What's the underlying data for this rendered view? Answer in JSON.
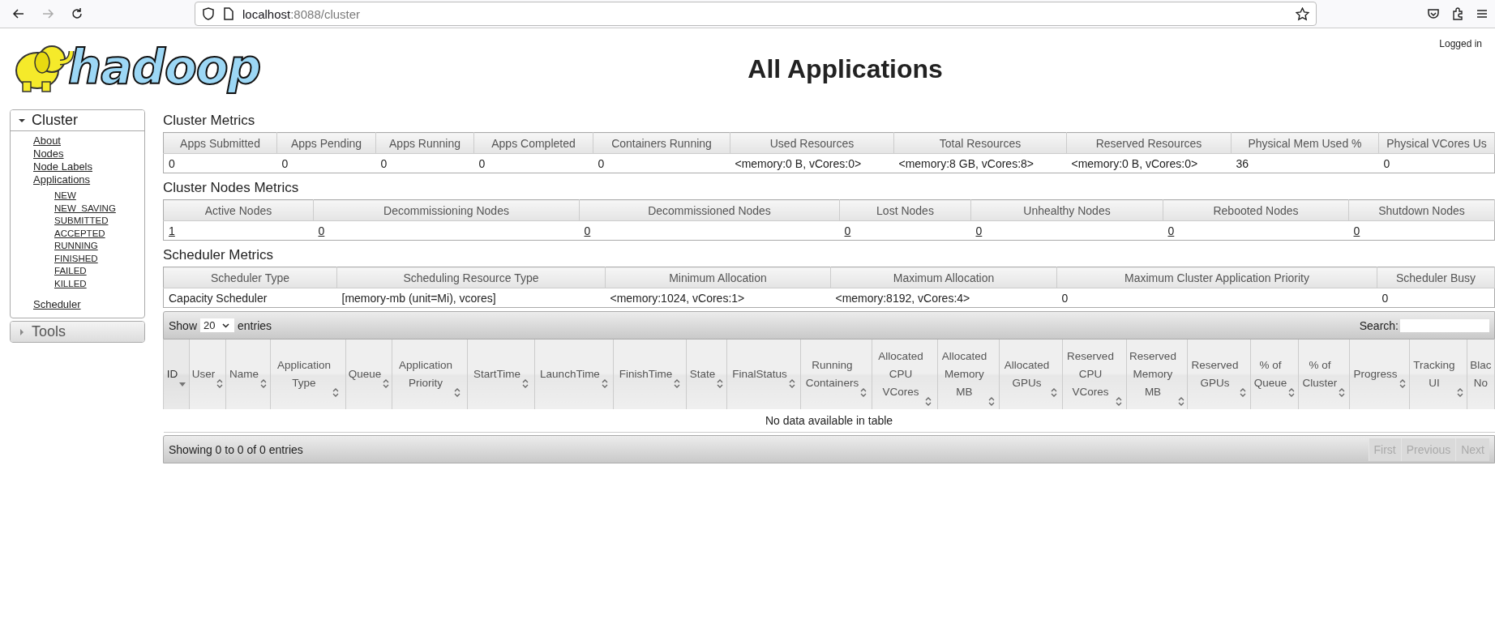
{
  "browser": {
    "back_disabled": false,
    "forward_disabled": true,
    "url_host": "localhost",
    "url_rest": ":8088/cluster"
  },
  "header": {
    "logo_text": "hadoop",
    "title": "All Applications",
    "logged_in": "Logged in"
  },
  "sidebar": [
    {
      "label": "Cluster",
      "expanded": true,
      "items": [
        {
          "label": "About"
        },
        {
          "label": "Nodes"
        },
        {
          "label": "Node Labels"
        },
        {
          "label": "Applications",
          "children": [
            {
              "label": "NEW"
            },
            {
              "label": "NEW_SAVING"
            },
            {
              "label": "SUBMITTED"
            },
            {
              "label": "ACCEPTED"
            },
            {
              "label": "RUNNING"
            },
            {
              "label": "FINISHED"
            },
            {
              "label": "FAILED"
            },
            {
              "label": "KILLED"
            }
          ]
        },
        {
          "label": "Scheduler"
        }
      ]
    },
    {
      "label": "Tools",
      "expanded": false
    }
  ],
  "metrics": [
    {
      "title": "Cluster Metrics",
      "links": false,
      "columns": [
        "Apps Submitted",
        "Apps Pending",
        "Apps Running",
        "Apps Completed",
        "Containers Running",
        "Used Resources",
        "Total Resources",
        "Reserved Resources",
        "Physical Mem Used %",
        "Physical VCores Us"
      ],
      "row": [
        "0",
        "0",
        "0",
        "0",
        "0",
        "<memory:0 B, vCores:0>",
        "<memory:8 GB, vCores:8>",
        "<memory:0 B, vCores:0>",
        "36",
        "0"
      ]
    },
    {
      "title": "Cluster Nodes Metrics",
      "links": true,
      "columns": [
        "Active Nodes",
        "Decommissioning Nodes",
        "Decommissioned Nodes",
        "Lost Nodes",
        "Unhealthy Nodes",
        "Rebooted Nodes",
        "Shutdown Nodes"
      ],
      "row": [
        "1",
        "0",
        "0",
        "0",
        "0",
        "0",
        "0"
      ]
    },
    {
      "title": "Scheduler Metrics",
      "links": false,
      "columns": [
        "Scheduler Type",
        "Scheduling Resource Type",
        "Minimum Allocation",
        "Maximum Allocation",
        "Maximum Cluster Application Priority",
        "Scheduler Busy"
      ],
      "row": [
        "Capacity Scheduler",
        "[memory-mb (unit=Mi), vcores]",
        "<memory:1024, vCores:1>",
        "<memory:8192, vCores:4>",
        "0",
        "0"
      ]
    }
  ],
  "apps": {
    "show_label": "Show",
    "page_length": "20",
    "entries_label": "entries",
    "search_label": "Search:",
    "columns": [
      {
        "label": "ID",
        "sortable": true,
        "sorted_desc": true
      },
      {
        "label": "User",
        "sortable": true,
        "sorted_desc": false
      },
      {
        "label": "Name",
        "sortable": true,
        "sorted_desc": false
      },
      {
        "label": "Application\nType",
        "sortable": true,
        "sorted_desc": false
      },
      {
        "label": "Queue",
        "sortable": true,
        "sorted_desc": false
      },
      {
        "label": "Application\nPriority",
        "sortable": true,
        "sorted_desc": false
      },
      {
        "label": "StartTime",
        "sortable": true,
        "sorted_desc": false
      },
      {
        "label": "LaunchTime",
        "sortable": true,
        "sorted_desc": false
      },
      {
        "label": "FinishTime",
        "sortable": true,
        "sorted_desc": false
      },
      {
        "label": "State",
        "sortable": true,
        "sorted_desc": false
      },
      {
        "label": "FinalStatus",
        "sortable": true,
        "sorted_desc": false
      },
      {
        "label": "Running\nContainers",
        "sortable": true,
        "sorted_desc": false
      },
      {
        "label": "Allocated\nCPU\nVCores",
        "sortable": true,
        "sorted_desc": false
      },
      {
        "label": "Allocated\nMemory\nMB",
        "sortable": true,
        "sorted_desc": false
      },
      {
        "label": "Allocated\nGPUs",
        "sortable": true,
        "sorted_desc": false
      },
      {
        "label": "Reserved\nCPU\nVCores",
        "sortable": true,
        "sorted_desc": false
      },
      {
        "label": "Reserved\nMemory\nMB",
        "sortable": true,
        "sorted_desc": false
      },
      {
        "label": "Reserved\nGPUs",
        "sortable": true,
        "sorted_desc": false
      },
      {
        "label": "% of\nQueue",
        "sortable": true,
        "sorted_desc": false
      },
      {
        "label": "% of\nCluster",
        "sortable": true,
        "sorted_desc": false
      },
      {
        "label": "Progress",
        "sortable": true,
        "sorted_desc": false
      },
      {
        "label": "Tracking\nUI",
        "sortable": true,
        "sorted_desc": false
      },
      {
        "label": "Blac\nNo",
        "sortable": false,
        "sorted_desc": false
      }
    ],
    "empty": "No data available in table",
    "info": "Showing 0 to 0 of 0 entries",
    "paginate": [
      {
        "label": "First",
        "disabled": true
      },
      {
        "label": "Previous",
        "disabled": true
      },
      {
        "label": "Next",
        "disabled": true
      }
    ]
  }
}
